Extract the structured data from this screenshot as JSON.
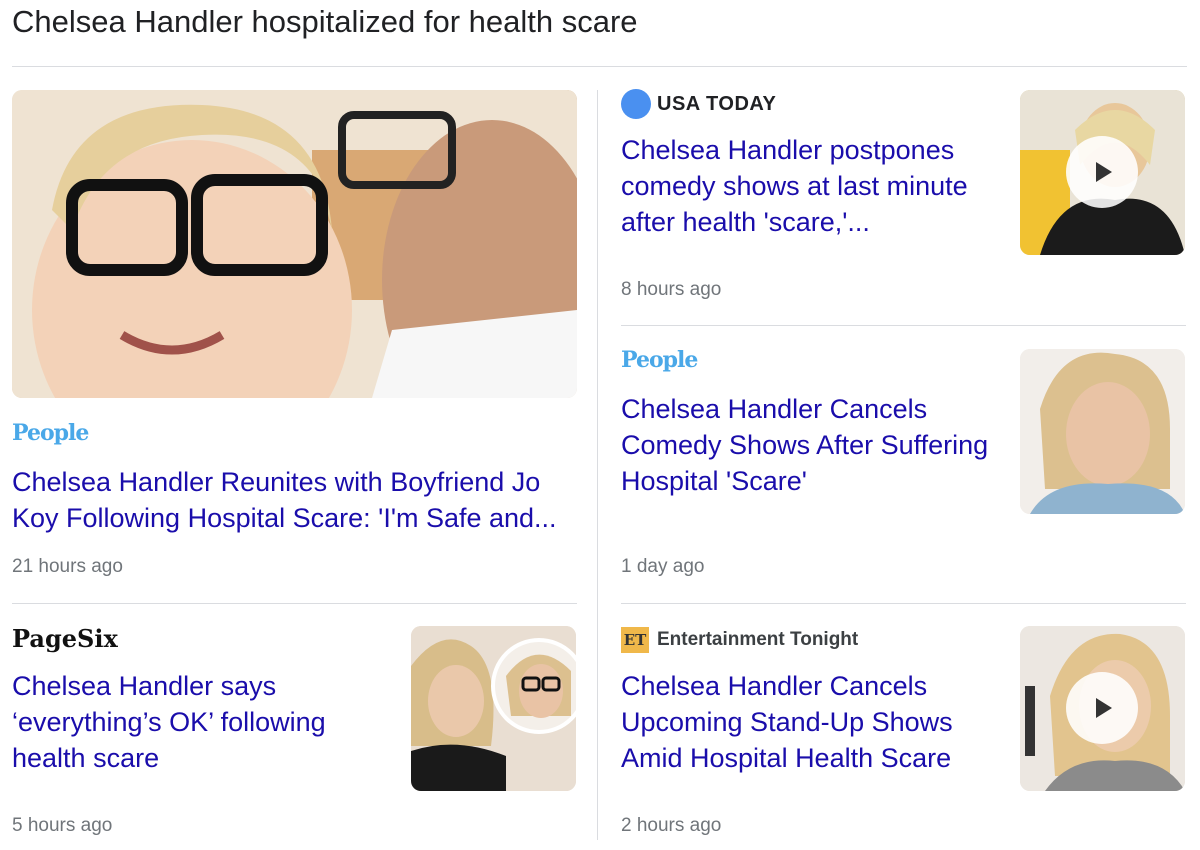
{
  "page": {
    "title": "Chelsea Handler hospitalized for health scare"
  },
  "colors": {
    "headline": "#1a0dab",
    "time": "#70757a",
    "divider": "#dadce0"
  },
  "articles": [
    {
      "source": "People",
      "headline": "Chelsea Handler Reunites with Boyfriend Jo Koy Following Hospital Scare: 'I'm Safe and...",
      "time": "21 hours ago",
      "has_video": false
    },
    {
      "source": "USA TODAY",
      "headline": "Chelsea Handler postpones comedy shows at last minute after health 'scare,'...",
      "time": "8 hours ago",
      "has_video": true
    },
    {
      "source": "People",
      "headline": "Chelsea Handler Cancels Comedy Shows After Suffering Hospital 'Scare'",
      "time": "1 day ago",
      "has_video": false
    },
    {
      "source": "PageSix",
      "headline": "Chelsea Handler says ‘everything’s OK’ following health scare",
      "time": "5 hours ago",
      "has_video": false
    },
    {
      "source": "Entertainment Tonight",
      "source_badge": "ET",
      "headline": "Chelsea Handler Cancels Upcoming Stand-Up Shows Amid Hospital Health Scare",
      "time": "2 hours ago",
      "has_video": true
    }
  ]
}
